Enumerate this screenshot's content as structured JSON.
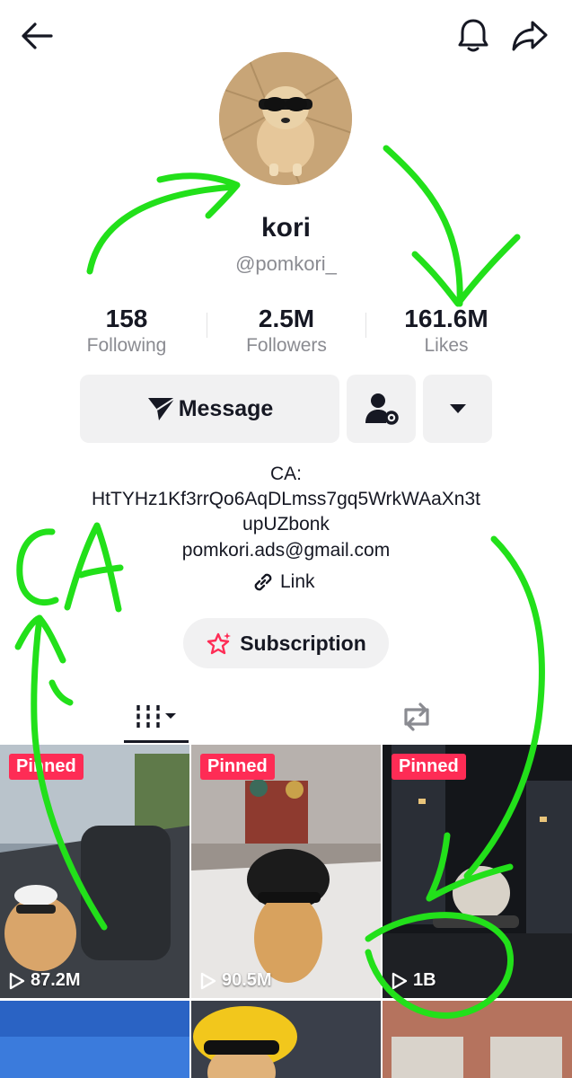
{
  "header": {
    "back_icon": "arrow-left-icon",
    "bell_icon": "bell-icon",
    "share_icon": "share-arrow-icon"
  },
  "profile": {
    "name": "kori",
    "handle": "@pomkori_"
  },
  "stats": [
    {
      "value": "158",
      "label": "Following"
    },
    {
      "value": "2.5M",
      "label": "Followers"
    },
    {
      "value": "161.6M",
      "label": "Likes"
    }
  ],
  "actions": {
    "message_label": "Message",
    "message_icon": "send-icon",
    "friends_icon": "person-gear-icon",
    "more_icon": "caret-down-icon"
  },
  "bio": {
    "line1": "CA:",
    "line2": "HtTYHz1Kf3rrQo6AqDLmss7gq5WrkWAaXn3t",
    "line3": "upUZbonk",
    "line4": "pomkori.ads@gmail.com",
    "link_label": "Link",
    "link_icon": "link-icon"
  },
  "subscription": {
    "label": "Subscription",
    "icon": "star-sparkle-icon"
  },
  "tabs": {
    "videos_icon": "grid-icon",
    "reposts_icon": "repost-icon"
  },
  "videos": [
    {
      "pinned": "Pinned",
      "views": "87.2M"
    },
    {
      "pinned": "Pinned",
      "views": "90.5M"
    },
    {
      "pinned": "Pinned",
      "views": "1B"
    }
  ],
  "annotation": {
    "handwritten_text": "CA",
    "color": "#22e01a"
  },
  "colors": {
    "accent": "#fe2c55",
    "text": "#161823",
    "muted": "#8a8b91",
    "button_bg": "#f1f1f2"
  }
}
